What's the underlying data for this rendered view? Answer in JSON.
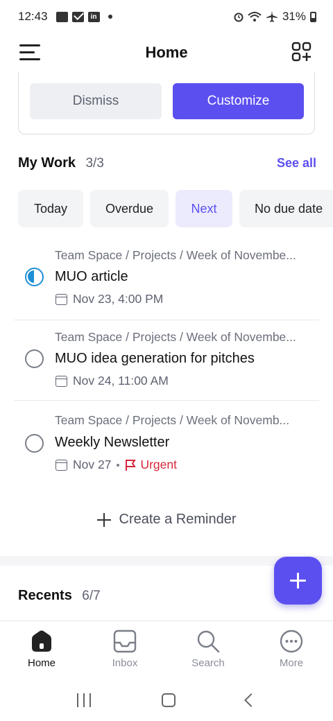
{
  "status_bar": {
    "time": "12:43",
    "battery": "31%",
    "icons": [
      "photo-icon",
      "mail-icon",
      "linkedin-icon",
      "alarm-icon",
      "wifi-icon",
      "airplane-icon",
      "battery-icon"
    ]
  },
  "header": {
    "title": "Home"
  },
  "banner": {
    "dismiss_label": "Dismiss",
    "customize_label": "Customize"
  },
  "my_work": {
    "title": "My Work",
    "count": "3/3",
    "see_all": "See all",
    "filters": [
      {
        "label": "Today",
        "active": false
      },
      {
        "label": "Overdue",
        "active": false
      },
      {
        "label": "Next",
        "active": true
      },
      {
        "label": "No due date",
        "active": false
      }
    ],
    "tasks": [
      {
        "path": "Team Space  /  Projects  /  Week of Novembe...",
        "title": "MUO article",
        "status": "in-progress",
        "date": "Nov 23,  4:00 PM"
      },
      {
        "path": "Team Space  /  Projects  /  Week of Novembe...",
        "title": "MUO idea generation for pitches",
        "status": "open",
        "date": "Nov 24,  11:00 AM"
      },
      {
        "path": "Team Space  /  Projects  /  Week of Novemb...",
        "title": "Weekly Newsletter",
        "status": "open",
        "date": "Nov 27",
        "priority": "Urgent"
      }
    ],
    "create_reminder": "Create a Reminder"
  },
  "recents": {
    "title": "Recents",
    "count": "6/7"
  },
  "bottom_nav": {
    "items": [
      {
        "label": "Home",
        "icon": "home-icon",
        "active": true
      },
      {
        "label": "Inbox",
        "icon": "inbox-icon",
        "active": false
      },
      {
        "label": "Search",
        "icon": "search-icon",
        "active": false
      },
      {
        "label": "More",
        "icon": "more-icon",
        "active": false
      }
    ]
  },
  "colors": {
    "accent": "#5b4ff0",
    "urgent": "#d6263a",
    "in_progress": "#1f8fd6"
  }
}
